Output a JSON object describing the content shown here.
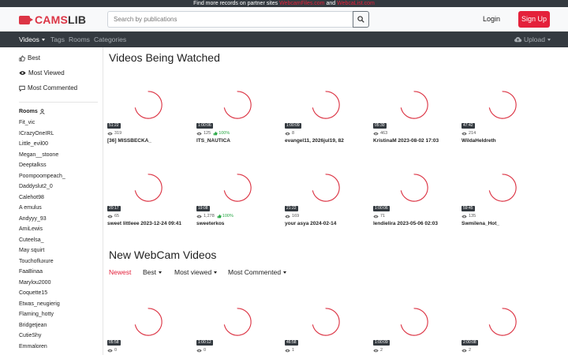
{
  "banner": {
    "text": "Find more records on partner sites",
    "link1": "WebcamFiles.com",
    "and": "and",
    "link2": "WebcaList.com"
  },
  "header": {
    "logo_part1": "CAMS",
    "logo_part2": "LIB",
    "search_placeholder": "Search by publications",
    "login": "Login",
    "signup": "Sign Up"
  },
  "nav": {
    "videos": "Videos",
    "tags": "Tags",
    "rooms": "Rooms",
    "categories": "Categories",
    "upload": "Upload"
  },
  "sidebar": {
    "links": [
      "Best",
      "Most Viewed",
      "Most Commented"
    ],
    "rooms_title": "Rooms",
    "rooms": [
      "Fit_vic",
      "ICrazyOneIRL",
      "Little_evil00",
      "Megan__stoone",
      "Deeptalkss",
      "Poompoompeach_",
      "Daddyslut2_0",
      "Calehot98",
      "A emulus",
      "Andyyy_93",
      "AmiLewis",
      "Cuteelsa_",
      "May squirt",
      "Touchofluxure",
      "FaaBinaa",
      "Marylou2000",
      "Coquette15",
      "Etwas_neugierig",
      "Flaming_hotty",
      "Bridgetjean",
      "CutieShy",
      "Emmaloren"
    ]
  },
  "sections": {
    "watched_title": "Videos Being Watched",
    "new_title": "New WebCam Videos"
  },
  "watched": [
    {
      "duration": "51:22",
      "views": "319",
      "rating": "",
      "title": "[36] MISSBECKA_"
    },
    {
      "duration": "1:00:06",
      "views": "125",
      "rating": "100%",
      "title": "ITS_NAUTICA"
    },
    {
      "duration": "1:00:09",
      "views": "8",
      "rating": "",
      "title": "evangel11, 2026jul19, 82"
    },
    {
      "duration": "05:30",
      "views": "463",
      "rating": "",
      "title": "KristinaM 2023-08-02 17:03"
    },
    {
      "duration": "47:42",
      "views": "214",
      "rating": "",
      "title": "WildaHeldreth"
    },
    {
      "duration": "20:17",
      "views": "65",
      "rating": "",
      "title": "sweet littleee 2023-12-24 09:41"
    },
    {
      "duration": "19:08",
      "views": "1,278",
      "rating": "100%",
      "title": "sweeterkos"
    },
    {
      "duration": "21:22",
      "views": "169",
      "rating": "",
      "title": "your asya 2024-02-14"
    },
    {
      "duration": "1:00:06",
      "views": "71",
      "rating": "",
      "title": "lendielira 2023-05-06 02:03"
    },
    {
      "duration": "59:45",
      "views": "135",
      "rating": "",
      "title": "Swmilena_Hot_"
    }
  ],
  "filters": {
    "newest": "Newest",
    "best": "Best",
    "most_viewed": "Most viewed",
    "most_commented": "Most Commented"
  },
  "new_videos": [
    {
      "duration": "05:58",
      "views": "0"
    },
    {
      "duration": "1:00:12",
      "views": "0"
    },
    {
      "duration": "46:58",
      "views": "1"
    },
    {
      "duration": "1:00:09",
      "views": "2"
    },
    {
      "duration": "2:00:08",
      "views": "2"
    }
  ],
  "colors": {
    "accent": "#e4213b",
    "dark": "#343a40",
    "rating": "#28a745"
  }
}
